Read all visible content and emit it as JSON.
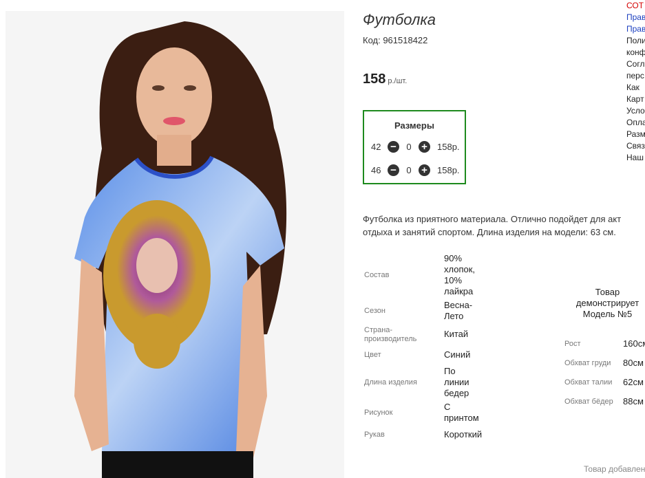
{
  "product": {
    "title": "Футболка",
    "code": "Код: 961518422",
    "price": "158",
    "price_unit": "р./шт."
  },
  "sizes": {
    "heading": "Размеры",
    "rows": [
      {
        "size": "42",
        "qty": "0",
        "price": "158р."
      },
      {
        "size": "46",
        "qty": "0",
        "price": "158р."
      }
    ],
    "minus_icon": "minus-circle-icon",
    "plus_icon": "plus-circle-icon"
  },
  "description": {
    "line1": "Футболка из приятного материала. Отлично подойдет для акт",
    "line2": "отдыха и занятий спортом. Длина изделия на модели: 63 см."
  },
  "attributes": [
    {
      "label": "Состав",
      "value_lines": [
        "90%",
        "хлопок,",
        "10%",
        "лайкра"
      ]
    },
    {
      "label": "Сезон",
      "value_lines": [
        "Весна-",
        "Лето"
      ]
    },
    {
      "label_lines": [
        "Страна-",
        "производитель"
      ],
      "value_lines": [
        "Китай"
      ]
    },
    {
      "label": "Цвет",
      "value_lines": [
        "Синий"
      ]
    },
    {
      "label": "Длина изделия",
      "value_lines": [
        "По",
        "линии",
        "бедер"
      ]
    },
    {
      "label": "Рисунок",
      "value_lines": [
        "С",
        "принтом"
      ]
    },
    {
      "label": "Рукав",
      "value_lines": [
        "Короткий"
      ]
    }
  ],
  "model": {
    "caption_lines": [
      "Товар",
      "демонстрирует",
      "Модель №5"
    ],
    "params": [
      {
        "label": "Рост",
        "value": "160см"
      },
      {
        "label": "Обхват груди",
        "value": "80см"
      },
      {
        "label": "Обхват талии",
        "value": "62см"
      },
      {
        "label": "Обхват бёдер",
        "value": "88см"
      }
    ]
  },
  "sidebar_links": [
    "СОТ",
    "Прав",
    "Прав",
    "Поли",
    "конф",
    "Согл",
    "перс",
    "Как",
    "Карт",
    "Усло",
    "Опла",
    "Разм",
    "Связ",
    "Наш"
  ],
  "footer": {
    "added_text": "Товар добавлен"
  },
  "colors": {
    "size_box_border": "#1d8a1d",
    "link_red": "#d40000",
    "link_blue": "#1b3fbf",
    "shirt_blue": "#4a7fe0"
  }
}
